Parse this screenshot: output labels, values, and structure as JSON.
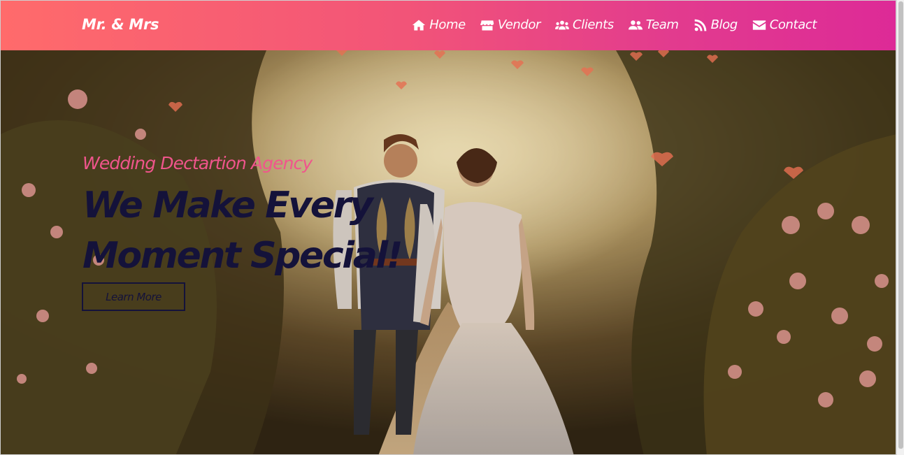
{
  "brand": {
    "name": "Mr. & Mrs"
  },
  "nav": {
    "items": [
      {
        "label": "Home",
        "icon": "home-icon"
      },
      {
        "label": "Vendor",
        "icon": "store-icon"
      },
      {
        "label": "Clients",
        "icon": "users-icon"
      },
      {
        "label": "Team",
        "icon": "user-friends-icon"
      },
      {
        "label": "Blog",
        "icon": "blog-icon"
      },
      {
        "label": "Contact",
        "icon": "envelope-icon"
      }
    ]
  },
  "hero": {
    "tagline": "Wedding Dectartion Agency",
    "headline": "We Make Every Moment Special!",
    "cta_label": "Learn More"
  },
  "colors": {
    "nav_gradient_start": "#ff6b6b",
    "nav_gradient_end": "#dd2a97",
    "tagline": "#f0558c",
    "headline": "#14123a"
  }
}
